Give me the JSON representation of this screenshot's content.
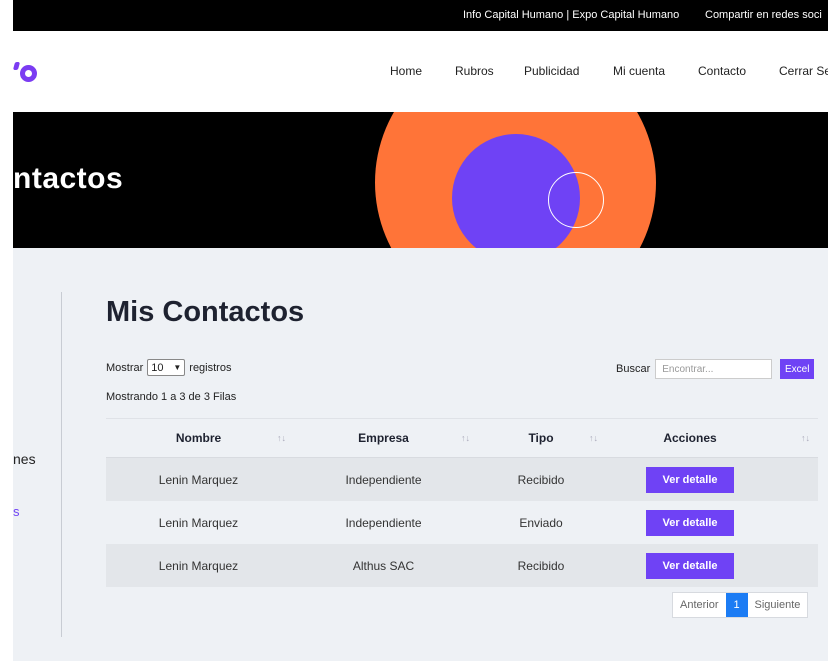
{
  "topbar": {
    "info": "Info Capital Humano | Expo Capital Humano",
    "share": "Compartir en redes soci"
  },
  "logo": {
    "icon": "brand-logo-icon",
    "color": "#7b3cf2"
  },
  "nav": {
    "items": [
      "Home",
      "Rubros",
      "Publicidad",
      "Mi cuenta",
      "Contacto",
      "Cerrar Se"
    ]
  },
  "hero": {
    "title": "ntactos",
    "colors": {
      "orange": "#ff7438",
      "purple": "#6f42f5"
    }
  },
  "sidebar": {
    "label": "nes",
    "link": "s"
  },
  "main": {
    "title": "Mis Contactos",
    "length": {
      "prefix": "Mostrar",
      "value": "10",
      "suffix": "registros"
    },
    "search": {
      "label": "Buscar",
      "placeholder": "Encontrar...",
      "value": ""
    },
    "excel_label": "Excel",
    "info": "Mostrando 1 a 3 de 3 Filas"
  },
  "table": {
    "headers": [
      "Nombre",
      "Empresa",
      "Tipo",
      "Acciones"
    ],
    "rows": [
      {
        "nombre": "Lenin Marquez",
        "empresa": "Independiente",
        "tipo": "Recibido",
        "accion": "Ver detalle"
      },
      {
        "nombre": "Lenin Marquez",
        "empresa": "Independiente",
        "tipo": "Enviado",
        "accion": "Ver detalle"
      },
      {
        "nombre": "Lenin Marquez",
        "empresa": "Althus SAC",
        "tipo": "Recibido",
        "accion": "Ver detalle"
      }
    ]
  },
  "pagination": {
    "prev": "Anterior",
    "current": "1",
    "next": "Siguiente"
  },
  "colors": {
    "accent": "#6f42f5",
    "page_active": "#1c7cf4"
  }
}
